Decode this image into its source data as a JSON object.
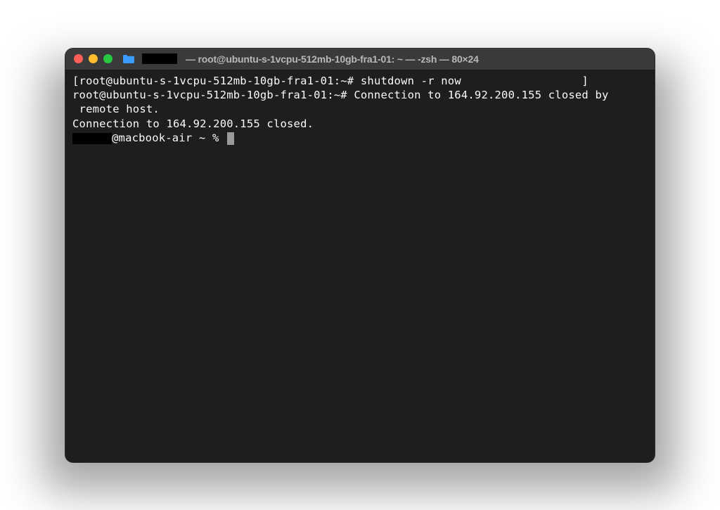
{
  "titlebar": {
    "title": "— root@ubuntu-s-1vcpu-512mb-10gb-fra1-01: ~ — -zsh — 80×24"
  },
  "terminal": {
    "line1_prompt": "[root@ubuntu-s-1vcpu-512mb-10gb-fra1-01:~# ",
    "line1_command": "shutdown -r now",
    "line1_suffix": "                  ]",
    "line2": "root@ubuntu-s-1vcpu-512mb-10gb-fra1-01:~# Connection to 164.92.200.155 closed by",
    "line3": " remote host.",
    "line4": "Connection to 164.92.200.155 closed.",
    "line5_host": "@macbook-air ~ % "
  }
}
